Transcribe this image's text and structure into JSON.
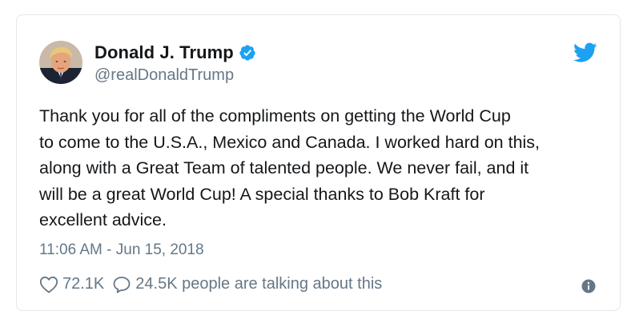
{
  "author": {
    "display_name": "Donald J. Trump",
    "handle": "@realDonaldTrump",
    "verified": true,
    "avatar_icon": "profile-avatar"
  },
  "tweet": {
    "text": "Thank you for all of the compliments on getting the World Cup\nto come to the U.S.A., Mexico and Canada. I worked hard on this,\nalong with a Great Team of talented people. We never fail, and it\nwill be a great World Cup! A special thanks to Bob Kraft for\nexcellent advice.",
    "timestamp": "11:06 AM - Jun 15, 2018"
  },
  "stats": {
    "likes": "72.1K",
    "talking": "24.5K people are talking about this"
  },
  "icons": {
    "brand": "twitter-bird-icon",
    "verified": "verified-badge-icon",
    "like": "heart-icon",
    "reply": "speech-bubble-icon",
    "info": "info-icon"
  },
  "colors": {
    "brand_blue": "#1da1f2",
    "text": "#14171a",
    "secondary_text": "#657786",
    "border": "#e1e8ed"
  }
}
